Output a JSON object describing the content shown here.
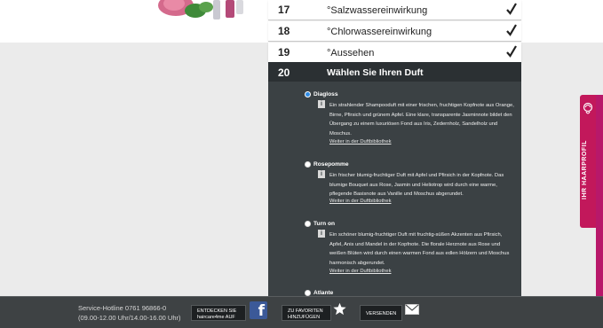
{
  "steps": [
    {
      "num": "17",
      "label": "°Salzwassereinwirkung"
    },
    {
      "num": "18",
      "label": "°Chlorwassereinwirkung"
    },
    {
      "num": "19",
      "label": "°Aussehen"
    }
  ],
  "active_step": {
    "num": "20",
    "title": "Wählen Sie Ihren Duft"
  },
  "scents": [
    {
      "name": "Diagloss",
      "selected": true,
      "description": "Ein strahlender Shampooduft mit einer frischen, fruchtigen Kopfnote aus Orange, Birne, Pfirsich und grünem Apfel. Eine klare, transparente Jasminnote bildet den Übergang zu einem luxuriösen Fond aus Iris, Zedernholz, Sandelholz und Moschus.",
      "link": "Weiter in der Duftbibliothek"
    },
    {
      "name": "Rosepomme",
      "selected": false,
      "description": "Ein frischer blumig-fruchtiger Duft mit Apfel und Pfirsich in der Kopfnote. Das blumige Bouquet aus Rose, Jasmin und Heliotrop wird durch eine warme, pflegende Basisnote aus Vanille und Moschus abgerundet.",
      "link": "Weiter in der Duftbibliothek"
    },
    {
      "name": "Turn on",
      "selected": false,
      "description": "Ein schöner blumig-fruchtiger Duft mit fruchtig-süßen Akzenten aus Pfirsich, Apfel, Anis und Mandel in der Kopfnote. Die florale Herznote aus Rose und weißen Blüten wird durch einen warmen Fond aus edlen Hölzern und Moschus harmonisch abgerundet.",
      "link": "Weiter in der Duftbibliothek"
    },
    {
      "name": "Atlante",
      "selected": false
    }
  ],
  "info_glyph": "i",
  "side_tab": {
    "label": "IHR HAARPROFIL"
  },
  "footer": {
    "hotline_line1": "Service-Hotline 0761 96866-0",
    "hotline_line2": "(09.00-12.00 Uhr/14.00-16.00 Uhr)",
    "facebook_line1": "ENTDECKEN SIE",
    "facebook_line2": "haircare4me AUF",
    "favorites_line1": "ZU FAVORITEN",
    "favorites_line2": "HINZUFÜGEN",
    "send_label": "VERSENDEN",
    "facebook_glyph": "f"
  },
  "colors": {
    "panel": "#3b4144",
    "panel_header": "#2b3033",
    "accent_pink": "#c2185b",
    "radio_selected": "#2f8be4",
    "footer": "#3e4244"
  }
}
